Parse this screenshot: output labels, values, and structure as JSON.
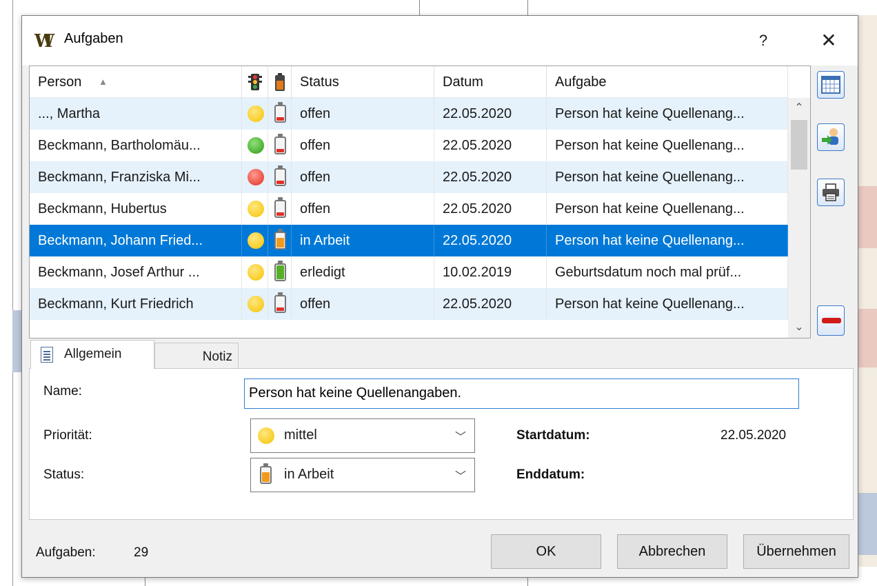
{
  "window": {
    "title": "Aufgaben",
    "help_label": "?",
    "close_label": "✕"
  },
  "table": {
    "columns": [
      {
        "label": "Person",
        "sort": "ascending"
      },
      {
        "label": "",
        "icon": "traffic-light-icon"
      },
      {
        "label": "",
        "icon": "battery-icon"
      },
      {
        "label": "Status"
      },
      {
        "label": "Datum"
      },
      {
        "label": "Aufgabe"
      }
    ],
    "rows": [
      {
        "person": "..., Martha",
        "priority": "yellow",
        "progress": "low",
        "status": "offen",
        "date": "22.05.2020",
        "task": "Person hat keine Quellenang..."
      },
      {
        "person": "Beckmann, Bartholomäu...",
        "priority": "green",
        "progress": "low",
        "status": "offen",
        "date": "22.05.2020",
        "task": "Person hat keine Quellenang..."
      },
      {
        "person": "Beckmann, Franziska Mi...",
        "priority": "red",
        "progress": "low",
        "status": "offen",
        "date": "22.05.2020",
        "task": "Person hat keine Quellenang..."
      },
      {
        "person": "Beckmann, Hubertus",
        "priority": "yellow",
        "progress": "low",
        "status": "offen",
        "date": "22.05.2020",
        "task": "Person hat keine Quellenang..."
      },
      {
        "person": "Beckmann, Johann Fried...",
        "priority": "yellow",
        "progress": "mid",
        "status": "in Arbeit",
        "date": "22.05.2020",
        "task": "Person hat keine Quellenang...",
        "selected": true
      },
      {
        "person": "Beckmann, Josef Arthur ...",
        "priority": "yellow",
        "progress": "full",
        "status": "erledigt",
        "date": "10.02.2019",
        "task": "Geburtsdatum noch mal prüf..."
      },
      {
        "person": "Beckmann, Kurt Friedrich",
        "priority": "yellow",
        "progress": "low",
        "status": "offen",
        "date": "22.05.2020",
        "task": "Person hat keine Quellenang..."
      }
    ]
  },
  "tabs": [
    {
      "label": "Allgemein",
      "active": true
    },
    {
      "label": "Notiz",
      "active": false
    }
  ],
  "form": {
    "name_label": "Name:",
    "name_value": "Person hat keine Quellenangaben.",
    "priority_label": "Priorität:",
    "priority_value": "mittel",
    "status_label": "Status:",
    "status_value": "in Arbeit",
    "start_label": "Startdatum:",
    "start_value": "22.05.2020",
    "end_label": "Enddatum:",
    "end_value": ""
  },
  "footer": {
    "count_label": "Aufgaben:",
    "count_value": "29",
    "ok_label": "OK",
    "cancel_label": "Abbrechen",
    "apply_label": "Übernehmen"
  },
  "colors": {
    "selection": "#0078d7",
    "row_alt": "#e5f1fb",
    "input_focus": "#2b7bd4"
  }
}
